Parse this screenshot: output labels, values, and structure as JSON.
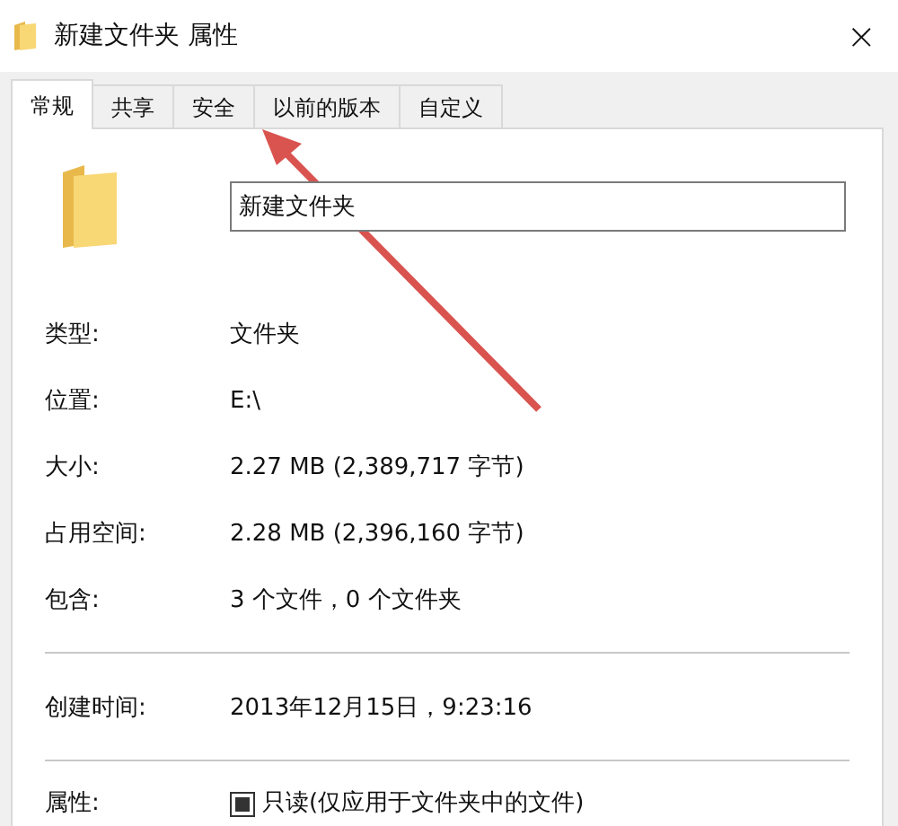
{
  "window": {
    "title": "新建文件夹 属性",
    "close": "×"
  },
  "tabs": [
    {
      "label": "常规",
      "selected": true
    },
    {
      "label": "共享",
      "selected": false
    },
    {
      "label": "安全",
      "selected": false
    },
    {
      "label": "以前的版本",
      "selected": false
    },
    {
      "label": "自定义",
      "selected": false
    }
  ],
  "name_field": {
    "value": "新建文件夹"
  },
  "groups": [
    [
      {
        "label": "类型:",
        "value": "文件夹"
      },
      {
        "label": "位置:",
        "value": "E:\\"
      },
      {
        "label": "大小:",
        "value": "2.27 MB (2,389,717 字节)"
      },
      {
        "label": "占用空间:",
        "value": "2.28 MB (2,396,160 字节)"
      },
      {
        "label": "包含:",
        "value": "3 个文件，0 个文件夹"
      }
    ],
    [
      {
        "label": "创建时间:",
        "value": "2013年12月15日，9:23:16"
      }
    ]
  ],
  "attributes": {
    "label": "属性:",
    "option": "只读(仅应用于文件夹中的文件)",
    "indeterminate": true
  },
  "annotation": {
    "kind": "arrow"
  }
}
